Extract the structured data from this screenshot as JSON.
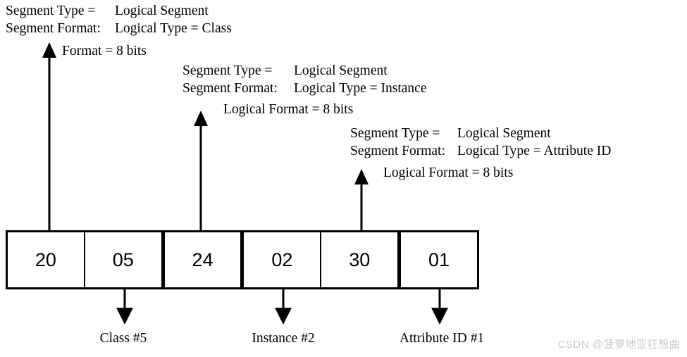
{
  "diagram": {
    "annotations": [
      {
        "id": "class-segment",
        "type_label": "Segment Type =",
        "type_value": "Logical Segment",
        "format_label": "Segment Format:",
        "format_value": "Logical Type = Class",
        "format_size": "Format = 8 bits"
      },
      {
        "id": "instance-segment",
        "type_label": "Segment Type =",
        "type_value": "Logical Segment",
        "format_label": "Segment Format:",
        "format_value": "Logical Type = Instance",
        "format_size": "Logical Format = 8 bits"
      },
      {
        "id": "attribute-segment",
        "type_label": "Segment Type =",
        "type_value": "Logical Segment",
        "format_label": "Segment Format:",
        "format_value": "Logical Type = Attribute ID",
        "format_size": "Logical Format = 8 bits"
      }
    ],
    "bytes": [
      {
        "value": "20"
      },
      {
        "value": "05"
      },
      {
        "value": "24"
      },
      {
        "value": "02"
      },
      {
        "value": "30"
      },
      {
        "value": "01"
      }
    ],
    "bottom_labels": [
      {
        "id": "class",
        "text": "Class #5"
      },
      {
        "id": "instance",
        "text": "Instance #2"
      },
      {
        "id": "attribute",
        "text": "Attribute ID #1"
      }
    ],
    "watermark": "CSDN @菠萝地亚狂想曲",
    "colors": {
      "background": "#ffffff",
      "ink": "#000000",
      "watermark": "#c9c9c9"
    }
  }
}
